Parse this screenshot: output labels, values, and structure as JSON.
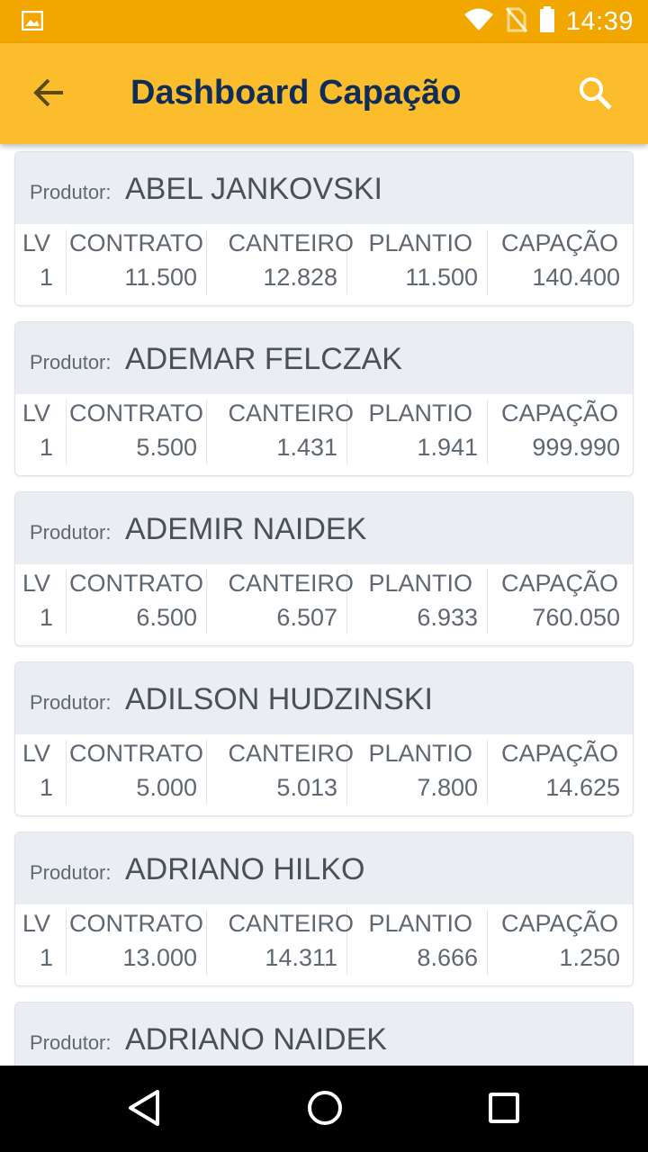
{
  "status_bar": {
    "time": "14:39",
    "icons": [
      "image-icon",
      "wifi-icon",
      "no-sim-icon",
      "battery-icon"
    ]
  },
  "app_bar": {
    "title": "Dashboard Capação",
    "back_icon": "arrow-back-icon",
    "search_icon": "search-icon"
  },
  "columns": [
    "LV",
    "CONTRATO",
    "CANTEIRO",
    "PLANTIO",
    "CAPAÇÃO"
  ],
  "producer_label": "Produtor:",
  "cards": [
    {
      "name": "ABEL JANKOVSKI",
      "lv": "1",
      "contrato": "11.500",
      "canteiro": "12.828",
      "plantio": "11.500",
      "capacao": "140.400"
    },
    {
      "name": "ADEMAR FELCZAK",
      "lv": "1",
      "contrato": "5.500",
      "canteiro": "1.431",
      "plantio": "1.941",
      "capacao": "999.990"
    },
    {
      "name": "ADEMIR NAIDEK",
      "lv": "1",
      "contrato": "6.500",
      "canteiro": "6.507",
      "plantio": "6.933",
      "capacao": "760.050"
    },
    {
      "name": "ADILSON HUDZINSKI",
      "lv": "1",
      "contrato": "5.000",
      "canteiro": "5.013",
      "plantio": "7.800",
      "capacao": "14.625"
    },
    {
      "name": "ADRIANO HILKO",
      "lv": "1",
      "contrato": "13.000",
      "canteiro": "14.311",
      "plantio": "8.666",
      "capacao": "1.250"
    },
    {
      "name": "ADRIANO NAIDEK"
    }
  ],
  "nav_bar": {
    "icons": [
      "back-triangle-icon",
      "home-circle-icon",
      "recents-square-icon"
    ]
  },
  "colors": {
    "status_bar": "#f2a600",
    "app_bar": "#fbbd2c",
    "title": "#0f2d57",
    "card_header": "#eaedf2"
  }
}
